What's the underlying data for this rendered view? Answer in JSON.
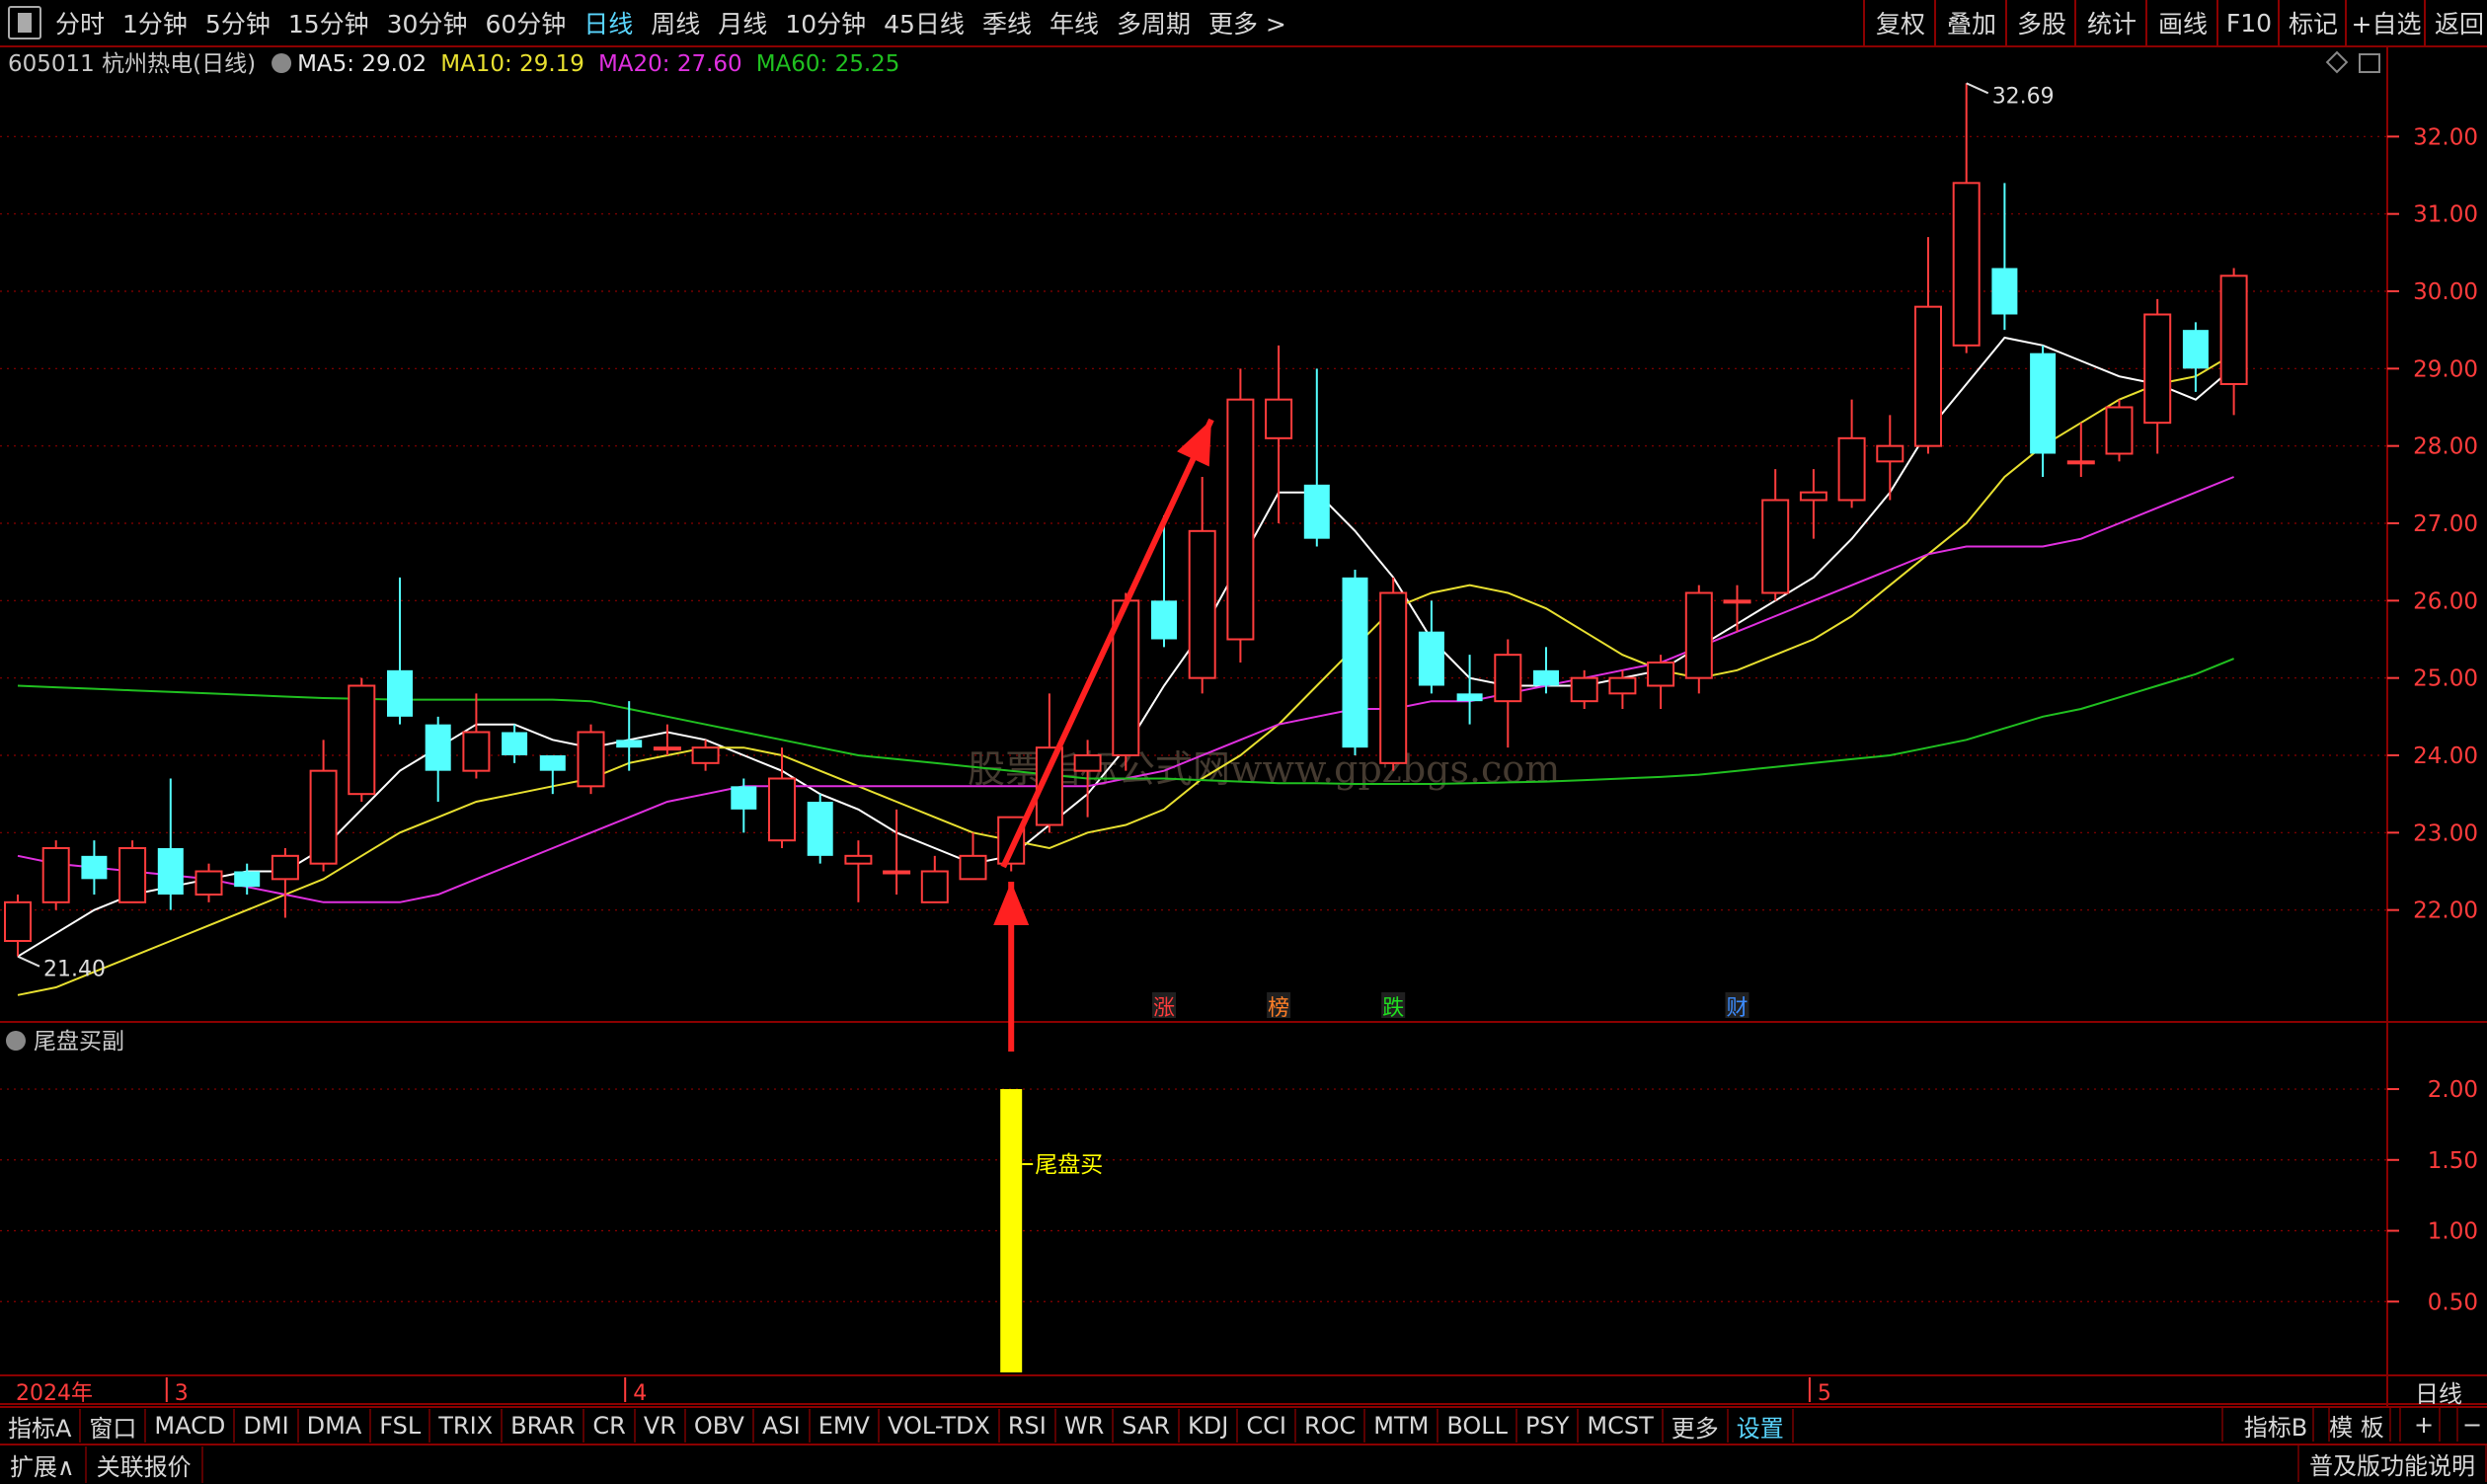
{
  "toolbar": {
    "periods": [
      "分时",
      "1分钟",
      "5分钟",
      "15分钟",
      "30分钟",
      "60分钟",
      "日线",
      "周线",
      "月线",
      "10分钟",
      "45日线",
      "季线",
      "年线",
      "多周期",
      "更多 >"
    ],
    "active_period": "日线",
    "right_tools": [
      "复权",
      "叠加",
      "多股",
      "统计",
      "画线",
      "F10",
      "标记",
      "+自选",
      "返回"
    ]
  },
  "main_chart_header": {
    "stock": "605011 杭州热电(日线)",
    "ma5": "MA5: 29.02",
    "ma10": "MA10: 29.19",
    "ma20": "MA20: 27.60",
    "ma60": "MA60: 25.25"
  },
  "sub_chart_header": {
    "title": "尾盘买副"
  },
  "bottom_bar": {
    "indicator_buttons": [
      "指标A",
      "窗口",
      "MACD",
      "DMI",
      "DMA",
      "FSL",
      "TRIX",
      "BRAR",
      "CR",
      "VR",
      "OBV",
      "ASI",
      "EMV",
      "VOL-TDX",
      "RSI",
      "WR",
      "SAR",
      "KDJ",
      "CCI",
      "ROC",
      "MTM",
      "BOLL",
      "PSY",
      "MCST",
      "更多",
      "设置"
    ],
    "right_buttons": [
      "指标B",
      "模 板",
      "+",
      "−"
    ],
    "period_label": "日线"
  },
  "bottom_bar2": {
    "left": [
      "扩展∧",
      "关联报价"
    ],
    "right": "普及版功能说明"
  },
  "watermark": "股票指标公式网www.gpzbgs.com",
  "colors": {
    "up": "#ff3c3c",
    "down": "#54ffff",
    "ma5": "#ffffff",
    "ma10": "#e8e030",
    "ma20": "#e030e0",
    "ma60": "#20c020",
    "grid": "#8b0000",
    "axis_text": "#ff3c3c",
    "signal": "#ffff00",
    "arrow": "#ff2020"
  },
  "chart_data": [
    {
      "type": "candlestick",
      "ylim": [
        21.0,
        33.0
      ],
      "y_ticks": [
        22.0,
        23.0,
        24.0,
        25.0,
        26.0,
        27.0,
        28.0,
        29.0,
        30.0,
        31.0,
        32.0
      ],
      "x_labels": [
        "2024年",
        "3",
        "4",
        "5"
      ],
      "high_label": "32.69",
      "low_label": "21.40",
      "event_markers": [
        {
          "label": "涨",
          "index": 30,
          "color": "#ff3c3c"
        },
        {
          "label": "榜",
          "index": 33,
          "color": "#ff7f27"
        },
        {
          "label": "跌",
          "index": 36,
          "color": "#20e020"
        },
        {
          "label": "财",
          "index": 45,
          "color": "#3c8cff"
        }
      ],
      "candles": [
        {
          "o": 21.6,
          "c": 22.1,
          "h": 22.2,
          "l": 21.4
        },
        {
          "o": 22.1,
          "c": 22.8,
          "h": 22.9,
          "l": 22.0
        },
        {
          "o": 22.7,
          "c": 22.4,
          "h": 22.9,
          "l": 22.2
        },
        {
          "o": 22.1,
          "c": 22.8,
          "h": 22.9,
          "l": 22.1
        },
        {
          "o": 22.8,
          "c": 22.2,
          "h": 23.7,
          "l": 22.0
        },
        {
          "o": 22.2,
          "c": 22.5,
          "h": 22.6,
          "l": 22.1
        },
        {
          "o": 22.5,
          "c": 22.3,
          "h": 22.6,
          "l": 22.2
        },
        {
          "o": 22.4,
          "c": 22.7,
          "h": 22.8,
          "l": 21.9
        },
        {
          "o": 22.6,
          "c": 23.8,
          "h": 24.2,
          "l": 22.5
        },
        {
          "o": 23.5,
          "c": 24.9,
          "h": 25.0,
          "l": 23.4
        },
        {
          "o": 25.1,
          "c": 24.5,
          "h": 26.3,
          "l": 24.4
        },
        {
          "o": 24.4,
          "c": 23.8,
          "h": 24.5,
          "l": 23.4
        },
        {
          "o": 23.8,
          "c": 24.3,
          "h": 24.8,
          "l": 23.7
        },
        {
          "o": 24.3,
          "c": 24.0,
          "h": 24.4,
          "l": 23.9
        },
        {
          "o": 24.0,
          "c": 23.8,
          "h": 24.0,
          "l": 23.5
        },
        {
          "o": 23.6,
          "c": 24.3,
          "h": 24.4,
          "l": 23.5
        },
        {
          "o": 24.2,
          "c": 24.1,
          "h": 24.7,
          "l": 23.8
        },
        {
          "o": 24.1,
          "c": 24.1,
          "h": 24.4,
          "l": 24.0
        },
        {
          "o": 23.9,
          "c": 24.1,
          "h": 24.2,
          "l": 23.8
        },
        {
          "o": 23.6,
          "c": 23.3,
          "h": 23.7,
          "l": 23.0
        },
        {
          "o": 22.9,
          "c": 23.7,
          "h": 24.1,
          "l": 22.8
        },
        {
          "o": 23.4,
          "c": 22.7,
          "h": 23.5,
          "l": 22.6
        },
        {
          "o": 22.6,
          "c": 22.7,
          "h": 22.9,
          "l": 22.1
        },
        {
          "o": 22.5,
          "c": 22.5,
          "h": 23.3,
          "l": 22.2
        },
        {
          "o": 22.1,
          "c": 22.5,
          "h": 22.7,
          "l": 22.1
        },
        {
          "o": 22.4,
          "c": 22.7,
          "h": 23.0,
          "l": 22.4
        },
        {
          "o": 22.6,
          "c": 23.2,
          "h": 23.2,
          "l": 22.5
        },
        {
          "o": 23.1,
          "c": 24.1,
          "h": 24.8,
          "l": 23.0
        },
        {
          "o": 23.8,
          "c": 24.0,
          "h": 24.2,
          "l": 23.2
        },
        {
          "o": 24.0,
          "c": 26.0,
          "h": 26.1,
          "l": 23.8
        },
        {
          "o": 26.0,
          "c": 25.5,
          "h": 27.1,
          "l": 25.4
        },
        {
          "o": 25.0,
          "c": 26.9,
          "h": 27.6,
          "l": 24.8
        },
        {
          "o": 25.5,
          "c": 28.6,
          "h": 29.0,
          "l": 25.2
        },
        {
          "o": 28.1,
          "c": 28.6,
          "h": 29.3,
          "l": 27.0
        },
        {
          "o": 27.5,
          "c": 26.8,
          "h": 29.0,
          "l": 26.7
        },
        {
          "o": 26.3,
          "c": 24.1,
          "h": 26.4,
          "l": 24.0
        },
        {
          "o": 23.9,
          "c": 26.1,
          "h": 26.3,
          "l": 23.8
        },
        {
          "o": 25.6,
          "c": 24.9,
          "h": 26.0,
          "l": 24.8
        },
        {
          "o": 24.8,
          "c": 24.7,
          "h": 25.3,
          "l": 24.4
        },
        {
          "o": 24.7,
          "c": 25.3,
          "h": 25.5,
          "l": 24.1
        },
        {
          "o": 25.1,
          "c": 24.9,
          "h": 25.4,
          "l": 24.8
        },
        {
          "o": 24.7,
          "c": 25.0,
          "h": 25.1,
          "l": 24.6
        },
        {
          "o": 24.8,
          "c": 25.0,
          "h": 25.1,
          "l": 24.6
        },
        {
          "o": 24.9,
          "c": 25.2,
          "h": 25.3,
          "l": 24.6
        },
        {
          "o": 25.0,
          "c": 26.1,
          "h": 26.2,
          "l": 24.8
        },
        {
          "o": 26.0,
          "c": 26.0,
          "h": 26.2,
          "l": 25.6
        },
        {
          "o": 26.1,
          "c": 27.3,
          "h": 27.7,
          "l": 26.0
        },
        {
          "o": 27.3,
          "c": 27.4,
          "h": 27.7,
          "l": 26.8
        },
        {
          "o": 27.3,
          "c": 28.1,
          "h": 28.6,
          "l": 27.2
        },
        {
          "o": 27.8,
          "c": 28.0,
          "h": 28.4,
          "l": 27.3
        },
        {
          "o": 28.0,
          "c": 29.8,
          "h": 30.7,
          "l": 27.9
        },
        {
          "o": 29.3,
          "c": 31.4,
          "h": 32.69,
          "l": 29.2
        },
        {
          "o": 30.3,
          "c": 29.7,
          "h": 31.4,
          "l": 29.5
        },
        {
          "o": 29.2,
          "c": 27.9,
          "h": 29.3,
          "l": 27.6
        },
        {
          "o": 27.8,
          "c": 27.8,
          "h": 28.3,
          "l": 27.6
        },
        {
          "o": 27.9,
          "c": 28.5,
          "h": 28.6,
          "l": 27.8
        },
        {
          "o": 28.3,
          "c": 29.7,
          "h": 29.9,
          "l": 27.9
        },
        {
          "o": 29.5,
          "c": 29.0,
          "h": 29.6,
          "l": 28.7
        },
        {
          "o": 28.8,
          "c": 30.2,
          "h": 30.3,
          "l": 28.4
        }
      ],
      "ma_lines": [
        {
          "name": "MA5",
          "color": "#ffffff",
          "values": [
            21.4,
            21.7,
            22.0,
            22.2,
            22.3,
            22.4,
            22.5,
            22.5,
            22.8,
            23.3,
            23.8,
            24.1,
            24.4,
            24.4,
            24.2,
            24.1,
            24.2,
            24.3,
            24.2,
            24.0,
            23.8,
            23.5,
            23.3,
            23.0,
            22.8,
            22.6,
            22.7,
            23.1,
            23.5,
            24.1,
            24.9,
            25.6,
            26.5,
            27.4,
            27.4,
            26.9,
            26.3,
            25.5,
            25.0,
            24.9,
            24.9,
            24.9,
            25.0,
            25.1,
            25.4,
            25.7,
            26.0,
            26.3,
            26.8,
            27.4,
            28.2,
            28.8,
            29.4,
            29.3,
            29.1,
            28.9,
            28.8,
            28.6,
            29.02
          ]
        },
        {
          "name": "MA10",
          "color": "#e8e030",
          "values": [
            20.9,
            21.0,
            21.2,
            21.4,
            21.6,
            21.8,
            22.0,
            22.2,
            22.4,
            22.7,
            23.0,
            23.2,
            23.4,
            23.5,
            23.6,
            23.7,
            23.9,
            24.0,
            24.1,
            24.1,
            24.0,
            23.8,
            23.6,
            23.4,
            23.2,
            23.0,
            22.9,
            22.8,
            23.0,
            23.1,
            23.3,
            23.7,
            24.0,
            24.4,
            24.9,
            25.4,
            25.9,
            26.1,
            26.2,
            26.1,
            25.9,
            25.6,
            25.3,
            25.1,
            25.0,
            25.1,
            25.3,
            25.5,
            25.8,
            26.2,
            26.6,
            27.0,
            27.6,
            28.0,
            28.3,
            28.6,
            28.8,
            28.9,
            29.19
          ]
        },
        {
          "name": "MA20",
          "color": "#e030e0",
          "values": [
            22.7,
            22.6,
            22.55,
            22.5,
            22.45,
            22.4,
            22.3,
            22.2,
            22.1,
            22.1,
            22.1,
            22.2,
            22.4,
            22.6,
            22.8,
            23.0,
            23.2,
            23.4,
            23.5,
            23.6,
            23.6,
            23.6,
            23.6,
            23.6,
            23.6,
            23.6,
            23.6,
            23.6,
            23.6,
            23.7,
            23.8,
            24.0,
            24.2,
            24.4,
            24.5,
            24.6,
            24.6,
            24.7,
            24.7,
            24.8,
            24.9,
            25.0,
            25.1,
            25.2,
            25.4,
            25.6,
            25.8,
            26.0,
            26.2,
            26.4,
            26.6,
            26.7,
            26.7,
            26.7,
            26.8,
            27.0,
            27.2,
            27.4,
            27.6
          ]
        },
        {
          "name": "MA60",
          "color": "#20c020",
          "values": [
            24.9,
            24.88,
            24.86,
            24.84,
            24.82,
            24.8,
            24.78,
            24.76,
            24.74,
            24.73,
            24.72,
            24.72,
            24.72,
            24.72,
            24.72,
            24.7,
            24.6,
            24.5,
            24.4,
            24.3,
            24.2,
            24.1,
            24.0,
            23.95,
            23.9,
            23.85,
            23.8,
            23.75,
            23.7,
            23.7,
            23.7,
            23.68,
            23.66,
            23.64,
            23.64,
            23.63,
            23.63,
            23.63,
            23.64,
            23.65,
            23.66,
            23.68,
            23.7,
            23.72,
            23.75,
            23.8,
            23.85,
            23.9,
            23.95,
            24.0,
            24.1,
            24.2,
            24.35,
            24.5,
            24.6,
            24.75,
            24.9,
            25.05,
            25.25
          ]
        }
      ]
    },
    {
      "type": "bar",
      "title": "尾盘买副",
      "ylim": [
        0,
        2.3
      ],
      "y_ticks": [
        0.5,
        1.0,
        1.5,
        2.0
      ],
      "signals": [
        {
          "index": 26,
          "value": 2.0,
          "label": "尾盘买"
        }
      ]
    }
  ]
}
